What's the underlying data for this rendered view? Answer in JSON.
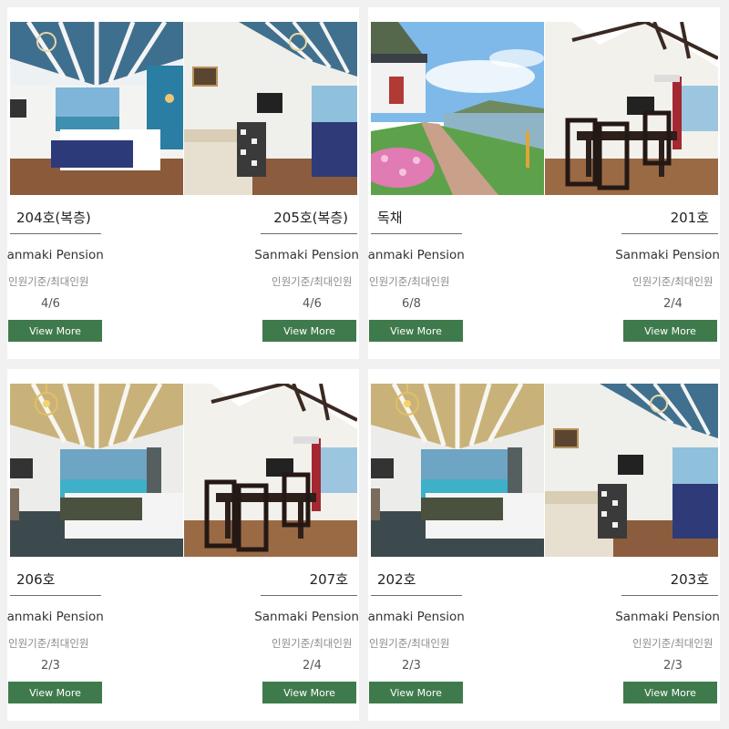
{
  "panels": [
    {
      "cards": [
        {
          "room": "204호(복층)",
          "pension": "Sanmaki Pension",
          "capacity_label": "인원기준/최대인원",
          "capacity": "4/6",
          "button": "View More",
          "photo": "bedroom-blue-ceiling"
        },
        {
          "room": "205호(복층)",
          "pension": "Sanmaki Pension",
          "capacity_label": "인원기준/최대인원",
          "capacity": "4/6",
          "button": "View More",
          "photo": "room-desk-bed"
        }
      ]
    },
    {
      "cards": [
        {
          "room": "독채",
          "pension": "Sanmaki Pension",
          "capacity_label": "인원기준/최대인원",
          "capacity": "6/8",
          "button": "View More",
          "photo": "exterior-river-view"
        },
        {
          "room": "201호",
          "pension": "Sanmaki Pension",
          "capacity_label": "인원기준/최대인원",
          "capacity": "2/4",
          "button": "View More",
          "photo": "dining-room"
        }
      ]
    },
    {
      "cards": [
        {
          "room": "206호",
          "pension": "Sanmaki Pension",
          "capacity_label": "인원기준/최대인원",
          "capacity": "2/3",
          "button": "View More",
          "photo": "bedroom-wood-ceiling"
        },
        {
          "room": "207호",
          "pension": "Sanmaki Pension",
          "capacity_label": "인원기준/최대인원",
          "capacity": "2/4",
          "button": "View More",
          "photo": "dining-room"
        }
      ]
    },
    {
      "cards": [
        {
          "room": "202호",
          "pension": "Sanmaki Pension",
          "capacity_label": "인원기준/최대인원",
          "capacity": "2/3",
          "button": "View More",
          "photo": "bedroom-wood-ceiling"
        },
        {
          "room": "203호",
          "pension": "Sanmaki Pension",
          "capacity_label": "인원기준/최대인원",
          "capacity": "2/3",
          "button": "View More",
          "photo": "room-desk-bed"
        }
      ]
    }
  ],
  "colors": {
    "button_bg": "#3f7a4c",
    "button_text": "#ffffff",
    "rule": "#6a6a6a",
    "room_text": "#222222",
    "label_text": "#8a8a8a"
  }
}
